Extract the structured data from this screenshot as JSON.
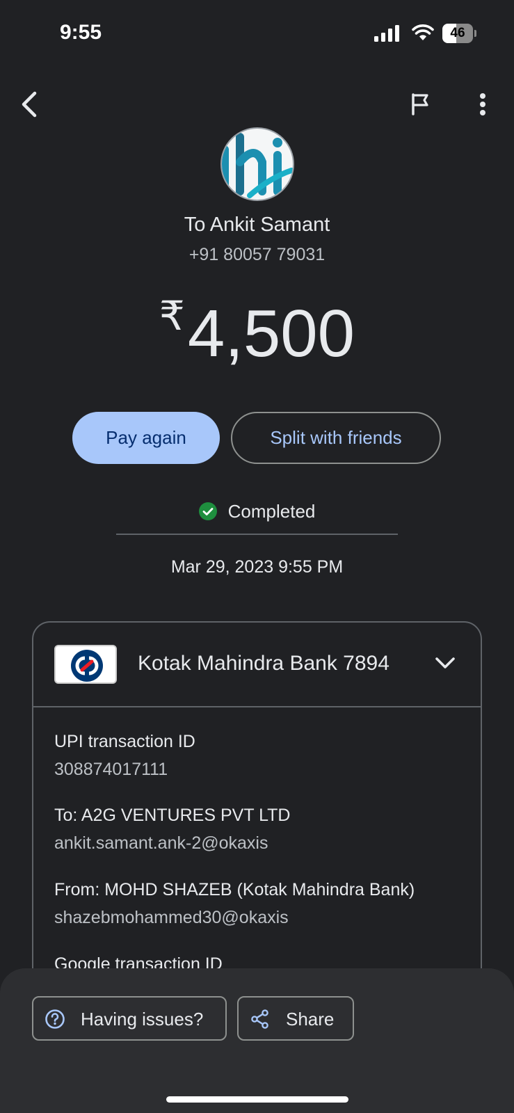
{
  "status_bar": {
    "time": "9:55",
    "battery_level": "46",
    "battery_percent": 46
  },
  "header": {
    "back_icon": "chevron-left-icon",
    "report_icon": "flag-icon",
    "more_icon": "more-vertical-icon"
  },
  "recipient": {
    "name_line": "To Ankit Samant",
    "phone": "+91 80057 79031",
    "avatar_text": "hi"
  },
  "payment": {
    "currency_symbol": "₹",
    "amount": "4,500"
  },
  "actions": {
    "pay_again_label": "Pay again",
    "split_label": "Split with friends"
  },
  "status": {
    "label": "Completed",
    "icon": "check-circle-icon",
    "color": "#1e8e3e"
  },
  "timestamp": "Mar 29, 2023 9:55 PM",
  "details": {
    "bank_account": "Kotak Mahindra Bank 7894",
    "bank_logo": "kotak-bank-logo",
    "expand_icon": "chevron-down-icon",
    "rows": [
      {
        "label": "UPI transaction ID",
        "value": "308874017111"
      },
      {
        "label": "To: A2G VENTURES PVT LTD",
        "value": "ankit.samant.ank-2@okaxis"
      },
      {
        "label": "From: MOHD  SHAZEB (Kotak Mahindra Bank)",
        "value": "shazebmohammed30@okaxis"
      },
      {
        "label": "Google transaction ID",
        "value": ""
      }
    ]
  },
  "bottom_sheet": {
    "issues_label": "Having issues?",
    "issues_icon": "help-circle-icon",
    "share_label": "Share",
    "share_icon": "share-icon"
  },
  "colors": {
    "background": "#202124",
    "accent": "#a8c7fa",
    "on_accent": "#062e6f",
    "sheet": "#2d2e31"
  }
}
